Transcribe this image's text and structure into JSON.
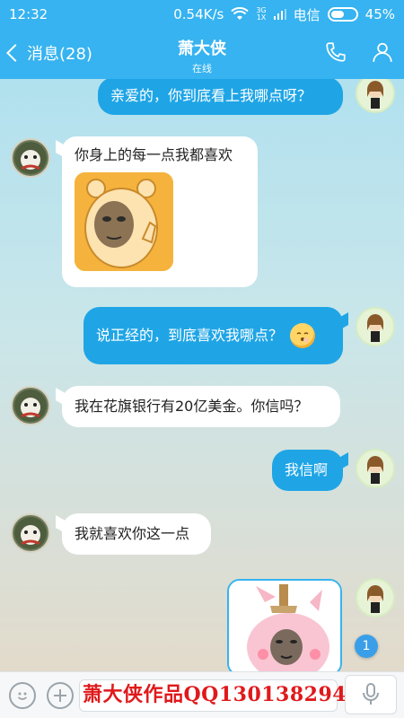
{
  "status_bar": {
    "time": "12:32",
    "net_speed": "0.54K/s",
    "network_type": "3G",
    "network_sub": "1X",
    "carrier": "电信",
    "battery_percent": "45%",
    "battery_level": 0.45
  },
  "header": {
    "back_label": "消息(28)",
    "title": "萧大侠",
    "subtitle": "在线",
    "icons": [
      "phone-icon",
      "profile-icon"
    ]
  },
  "messages": [
    {
      "from": "me",
      "type": "text",
      "text": "亲爱的，你到底看上我哪点呀？"
    },
    {
      "from": "other",
      "type": "text_image",
      "text": "你身上的每一点我都喜欢",
      "image": "meme-sticker"
    },
    {
      "from": "me",
      "type": "text_emoji",
      "text": "说正经的，到底喜欢我哪点？",
      "emoji": "shy-emoji"
    },
    {
      "from": "other",
      "type": "text",
      "text": "我在花旗银行有20亿美金。你信吗？"
    },
    {
      "from": "me",
      "type": "text",
      "text": "我信啊"
    },
    {
      "from": "other",
      "type": "text",
      "text": "我就喜欢你这一点"
    },
    {
      "from": "me",
      "type": "sticker",
      "image": "pig-sticker"
    }
  ],
  "unread_badge": "1",
  "input_bar": {
    "watermark": "萧大侠作品QQ130138294",
    "icons": [
      "emoji-icon",
      "plus-icon",
      "mic-icon"
    ]
  },
  "colors": {
    "accent": "#36b3f0",
    "my_bubble": "#1fa5e6",
    "other_bubble": "#ffffff",
    "watermark": "#e0191b"
  }
}
